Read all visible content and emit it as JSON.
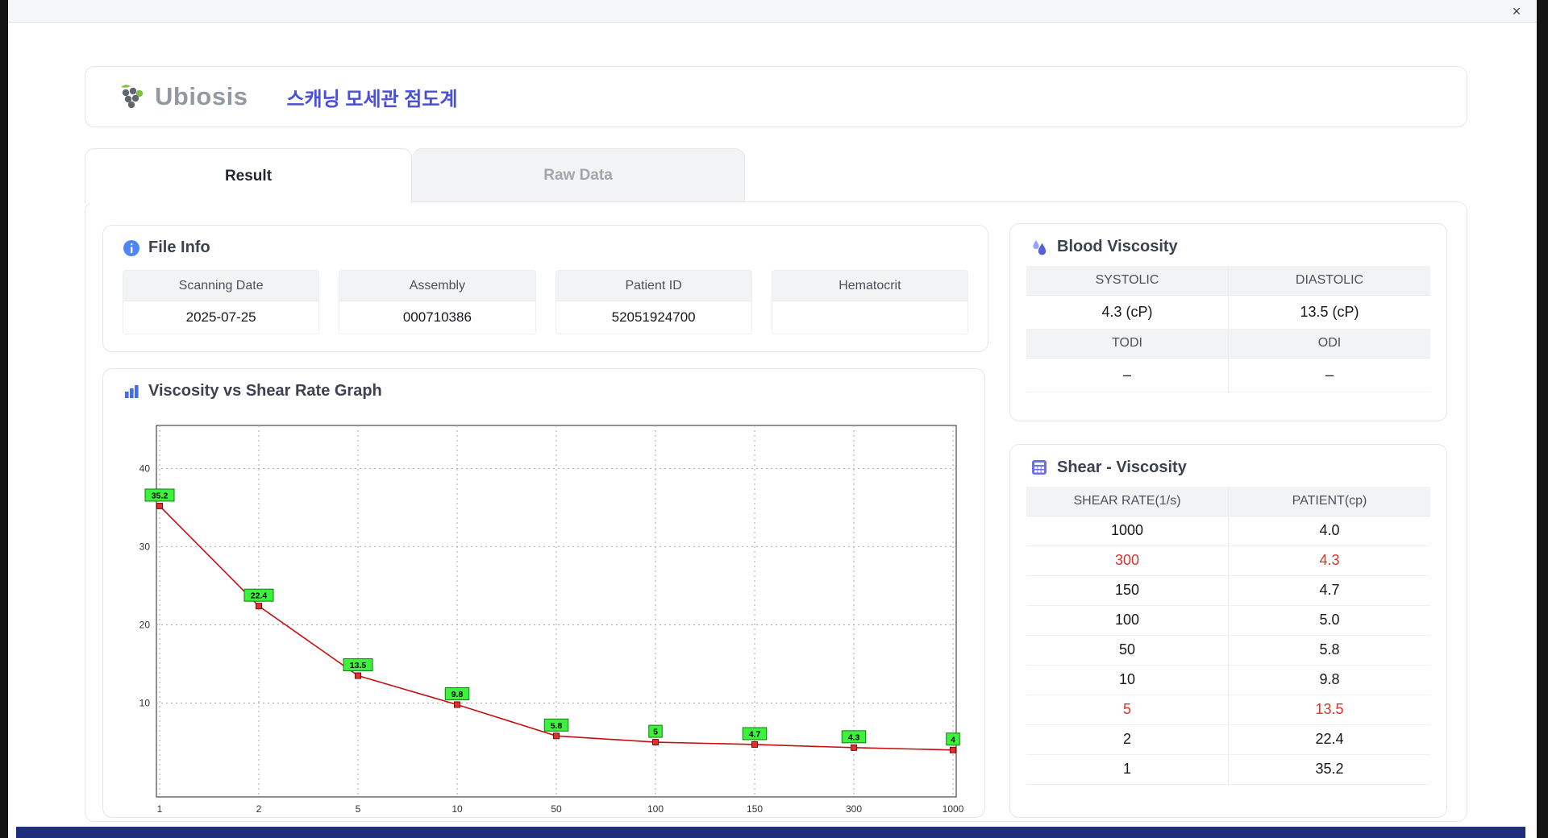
{
  "window": {
    "close_label": "×"
  },
  "header": {
    "brand": "Ubiosis",
    "title": "스캐닝 모세관 점도계"
  },
  "tabs": {
    "result": "Result",
    "raw_data": "Raw Data"
  },
  "file_info": {
    "title": "File Info",
    "fields": [
      {
        "label": "Scanning Date",
        "value": "2025-07-25"
      },
      {
        "label": "Assembly",
        "value": "000710386"
      },
      {
        "label": "Patient ID",
        "value": "52051924700"
      },
      {
        "label": "Hematocrit",
        "value": ""
      }
    ]
  },
  "graph": {
    "title": "Viscosity vs Shear Rate Graph"
  },
  "blood_viscosity": {
    "title": "Blood Viscosity",
    "headers1": [
      "SYSTOLIC",
      "DIASTOLIC"
    ],
    "values1": [
      "4.3 (cP)",
      "13.5 (cP)"
    ],
    "headers2": [
      "TODI",
      "ODI"
    ],
    "values2": [
      "–",
      "–"
    ]
  },
  "shear_viscosity": {
    "title": "Shear - Viscosity",
    "columns": [
      "SHEAR RATE(1/s)",
      "PATIENT(cp)"
    ],
    "rows": [
      {
        "shear": "1000",
        "patient": "4.0",
        "highlight": false
      },
      {
        "shear": "300",
        "patient": "4.3",
        "highlight": true
      },
      {
        "shear": "150",
        "patient": "4.7",
        "highlight": false
      },
      {
        "shear": "100",
        "patient": "5.0",
        "highlight": false
      },
      {
        "shear": "50",
        "patient": "5.8",
        "highlight": false
      },
      {
        "shear": "10",
        "patient": "9.8",
        "highlight": false
      },
      {
        "shear": "5",
        "patient": "13.5",
        "highlight": true
      },
      {
        "shear": "2",
        "patient": "22.4",
        "highlight": false
      },
      {
        "shear": "1",
        "patient": "35.2",
        "highlight": false
      }
    ]
  },
  "chart_data": {
    "type": "line",
    "title": "Viscosity vs Shear Rate Graph",
    "x_scale": "category",
    "x_categories": [
      "1",
      "2",
      "5",
      "10",
      "50",
      "100",
      "150",
      "300",
      "1000"
    ],
    "values": [
      35.2,
      22.4,
      13.5,
      9.8,
      5.8,
      5,
      4.7,
      4.3,
      4
    ],
    "point_labels": [
      "35.2",
      "22.4",
      "13.5",
      "9.8",
      "5.8",
      "5",
      "4.7",
      "4.3",
      "4"
    ],
    "xlabel": "",
    "ylabel": "",
    "y_ticks": [
      10,
      20,
      30,
      40
    ],
    "ylim": [
      -2,
      45.5
    ],
    "grid": "dashed",
    "legend": "none",
    "line_color": "#c40f0f",
    "marker_color": "#e03131",
    "marker_edge": "#7a0b0b",
    "label_bg": "#3df23d",
    "label_edge": "#0f7a0f"
  },
  "colors": {
    "accent_blue": "#4a4fd6",
    "highlight_red": "#d3342c",
    "header_gray": "#f1f3f5",
    "bottom_bar": "#1d2e7d",
    "logo_green": "#7cc142",
    "logo_gray": "#62676e"
  }
}
